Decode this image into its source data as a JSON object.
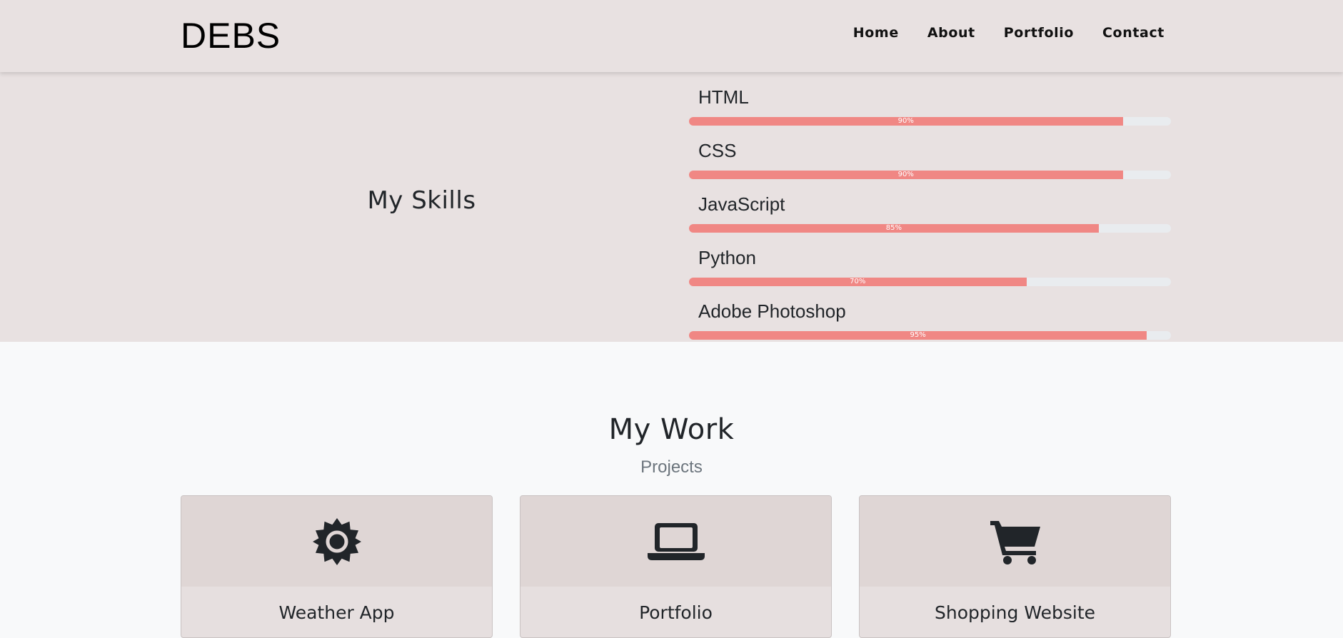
{
  "nav": {
    "brand": "DEBS",
    "links": [
      "Home",
      "About",
      "Portfolio",
      "Contact"
    ]
  },
  "skills": {
    "heading": "My Skills",
    "items": [
      {
        "name": "HTML",
        "percent": 90,
        "label": "90%"
      },
      {
        "name": "CSS",
        "percent": 90,
        "label": "90%"
      },
      {
        "name": "JavaScript",
        "percent": 85,
        "label": "85%"
      },
      {
        "name": "Python",
        "percent": 70,
        "label": "70%"
      },
      {
        "name": "Adobe Photoshop",
        "percent": 95,
        "label": "95%"
      }
    ],
    "bar_color": "#f08784"
  },
  "work": {
    "title": "My Work",
    "subtitle": "Projects",
    "projects": [
      {
        "title": "Weather App",
        "icon": "sun-icon"
      },
      {
        "title": "Portfolio",
        "icon": "laptop-icon"
      },
      {
        "title": "Shopping Website",
        "icon": "shopping-cart-icon"
      }
    ]
  }
}
